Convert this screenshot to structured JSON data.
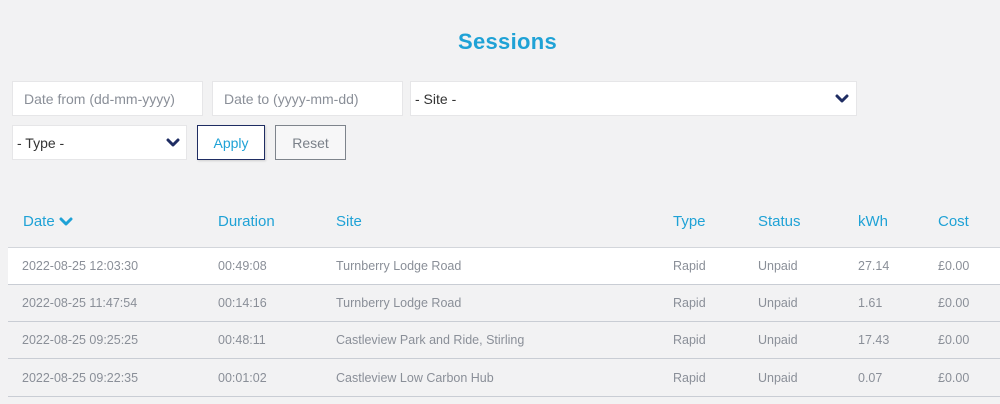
{
  "page": {
    "title": "Sessions"
  },
  "filters": {
    "date_from_placeholder": "Date from (dd-mm-yyyy)",
    "date_to_placeholder": "Date to (yyyy-mm-dd)",
    "site_selected": "- Site -",
    "type_selected": "- Type -",
    "apply_label": "Apply",
    "reset_label": "Reset",
    "chevron_icon": "chevron-down-icon"
  },
  "table": {
    "columns": [
      "Date",
      "Duration",
      "Site",
      "Type",
      "Status",
      "kWh",
      "Cost"
    ],
    "sort_column": "Date",
    "sort_direction": "descending",
    "rows": [
      [
        "2022-08-25 12:03:30",
        "00:49:08",
        "Turnberry Lodge Road",
        "Rapid",
        "Unpaid",
        "27.14",
        "£0.00"
      ],
      [
        "2022-08-25 11:47:54",
        "00:14:16",
        "Turnberry Lodge Road",
        "Rapid",
        "Unpaid",
        "1.61",
        "£0.00"
      ],
      [
        "2022-08-25 09:25:25",
        "00:48:11",
        "Castleview Park and Ride, Stirling",
        "Rapid",
        "Unpaid",
        "17.43",
        "£0.00"
      ],
      [
        "2022-08-25 09:22:35",
        "00:01:02",
        "Castleview Low Carbon Hub",
        "Rapid",
        "Unpaid",
        "0.07",
        "£0.00"
      ]
    ]
  },
  "colors": {
    "accent": "#1fa2d6",
    "navy": "#1f2d63",
    "background": "#f2f2f3"
  }
}
